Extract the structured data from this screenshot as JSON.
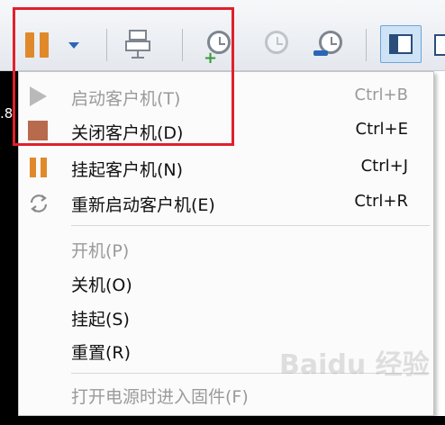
{
  "toolbar": {
    "pause_icon": "pause-icon",
    "dropdown_icon": "dropdown-arrow-icon",
    "snapshot_icon": "snapshot-manager-icon",
    "colors": {
      "pause": "#e0892b",
      "dropdown": "#2a66b8",
      "highlight": "#e0202b"
    }
  },
  "background_text": ".8",
  "menu": {
    "items": [
      {
        "label": "启动客户机(T)",
        "shortcut": "Ctrl+B",
        "enabled": false,
        "icon": "play-icon"
      },
      {
        "label": "关闭客户机(D)",
        "shortcut": "Ctrl+E",
        "enabled": true,
        "icon": "stop-icon"
      },
      {
        "label": "挂起客户机(N)",
        "shortcut": "Ctrl+J",
        "enabled": true,
        "icon": "pause-icon"
      },
      {
        "label": "重新启动客户机(E)",
        "shortcut": "Ctrl+R",
        "enabled": true,
        "icon": "restart-icon"
      },
      {
        "label": "开机(P)",
        "shortcut": "",
        "enabled": false
      },
      {
        "label": "关机(O)",
        "shortcut": "",
        "enabled": true
      },
      {
        "label": "挂起(S)",
        "shortcut": "",
        "enabled": true
      },
      {
        "label": "重置(R)",
        "shortcut": "",
        "enabled": true
      },
      {
        "label": "打开电源时进入固件(F)",
        "shortcut": "",
        "enabled": false
      }
    ]
  },
  "watermark": "Baidu 经验"
}
